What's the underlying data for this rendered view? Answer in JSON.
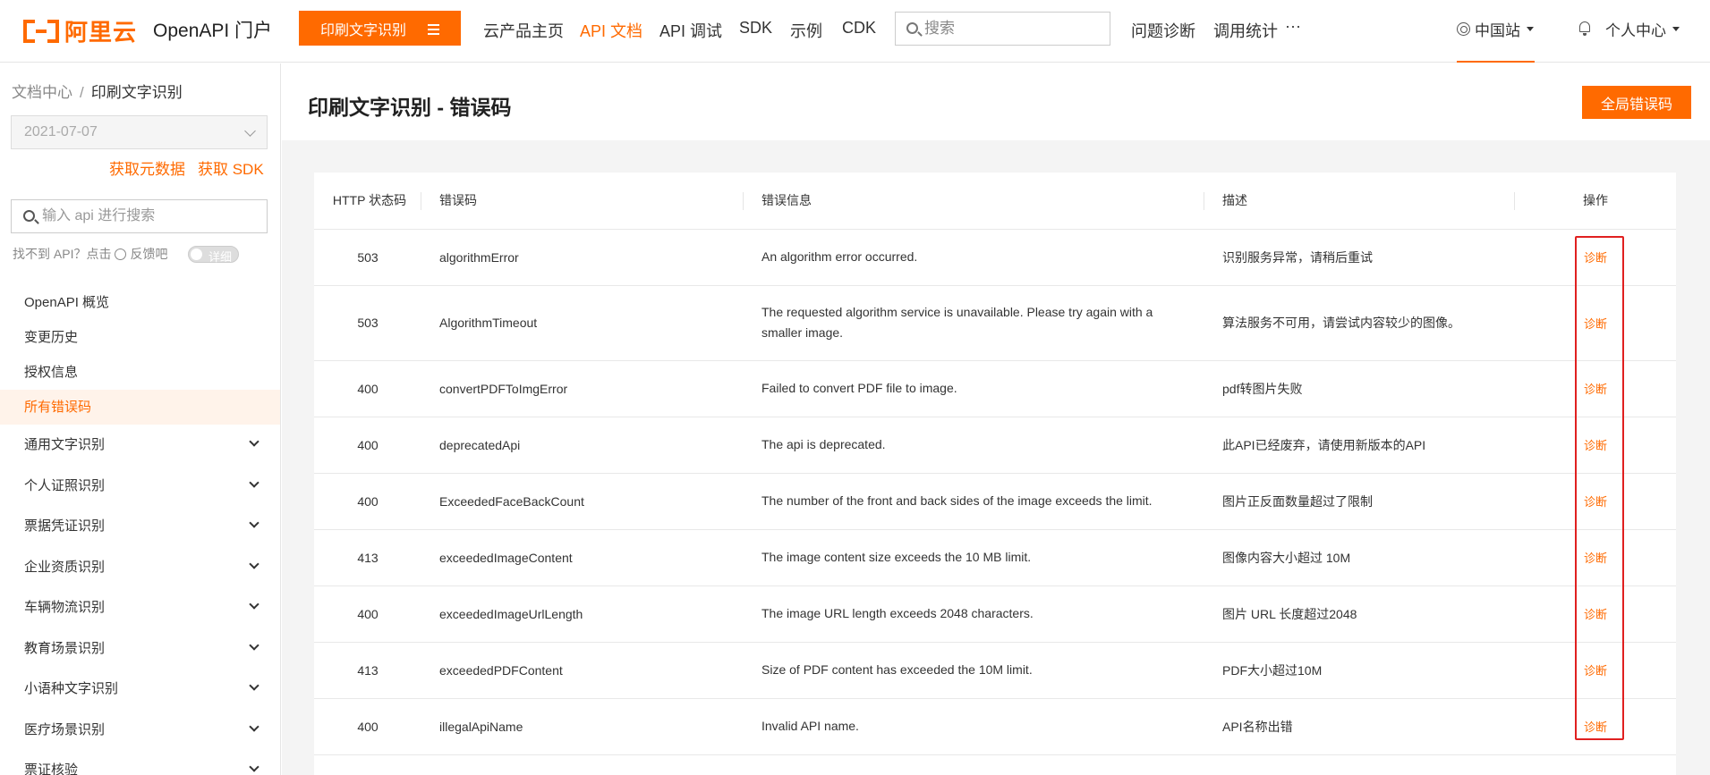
{
  "brand": {
    "logo_text": "阿里云",
    "portal_title": "OpenAPI 门户",
    "accent": "#ff6a00"
  },
  "topnav": {
    "product_button": "印刷文字识别",
    "items": [
      "云产品主页",
      "API 文档",
      "API 调试",
      "SDK",
      "示例",
      "CDK"
    ],
    "active_item": "API 文档",
    "search_placeholder": "搜索",
    "right_items": [
      "问题诊断",
      "调用统计"
    ],
    "more": "···",
    "region": "中国站",
    "user_center": "个人中心"
  },
  "sidebar": {
    "breadcrumb": [
      "文档中心",
      "印刷文字识别"
    ],
    "breadcrumb_sep": "/",
    "version": "2021-07-07",
    "meta_links": [
      "获取元数据",
      "获取 SDK"
    ],
    "api_search_placeholder": "输入 api 进行搜索",
    "feedback_prefix": "找不到 API？点击",
    "feedback_link": "反馈吧",
    "toggle_label": "详细",
    "items": [
      {
        "label": "OpenAPI 概览"
      },
      {
        "label": "变更历史"
      },
      {
        "label": "授权信息"
      },
      {
        "label": "所有错误码",
        "active": true
      }
    ],
    "groups": [
      "通用文字识别",
      "个人证照识别",
      "票据凭证识别",
      "企业资质识别",
      "车辆物流识别",
      "教育场景识别",
      "小语种文字识别",
      "医疗场景识别",
      "票证核验"
    ]
  },
  "main": {
    "title": "印刷文字识别 - 错误码",
    "global_button": "全局错误码",
    "table": {
      "headers": [
        "HTTP 状态码",
        "错误码",
        "错误信息",
        "描述",
        "操作"
      ],
      "rows": [
        {
          "status": "503",
          "code": "algorithmError",
          "message": "An algorithm error occurred.",
          "desc": "识别服务异常，请稍后重试",
          "op": "诊断"
        },
        {
          "status": "503",
          "code": "AlgorithmTimeout",
          "message": "The requested algorithm service is unavailable. Please try again with a smaller image.",
          "desc": "算法服务不可用，请尝试内容较少的图像。",
          "op": "诊断"
        },
        {
          "status": "400",
          "code": "convertPDFToImgError",
          "message": "Failed to convert PDF file to image.",
          "desc": "pdf转图片失败",
          "op": "诊断"
        },
        {
          "status": "400",
          "code": "deprecatedApi",
          "message": "The api is deprecated.",
          "desc": "此API已经废弃，请使用新版本的API",
          "op": "诊断"
        },
        {
          "status": "400",
          "code": "ExceededFaceBackCount",
          "message": "The number of the front and back sides of the image exceeds the limit.",
          "desc": "图片正反面数量超过了限制",
          "op": "诊断"
        },
        {
          "status": "413",
          "code": "exceededImageContent",
          "message": "The image content size exceeds the 10 MB limit.",
          "desc": "图像内容大小超过 10M",
          "op": "诊断"
        },
        {
          "status": "400",
          "code": "exceededImageUrlLength",
          "message": "The image URL length exceeds 2048 characters.",
          "desc": "图片 URL 长度超过2048",
          "op": "诊断"
        },
        {
          "status": "413",
          "code": "exceededPDFContent",
          "message": "Size of PDF content has exceeded the 10M limit.",
          "desc": "PDF大小超过10M",
          "op": "诊断"
        },
        {
          "status": "400",
          "code": "illegalApiName",
          "message": "Invalid API name.",
          "desc": "API名称出错",
          "op": "诊断"
        }
      ]
    }
  }
}
